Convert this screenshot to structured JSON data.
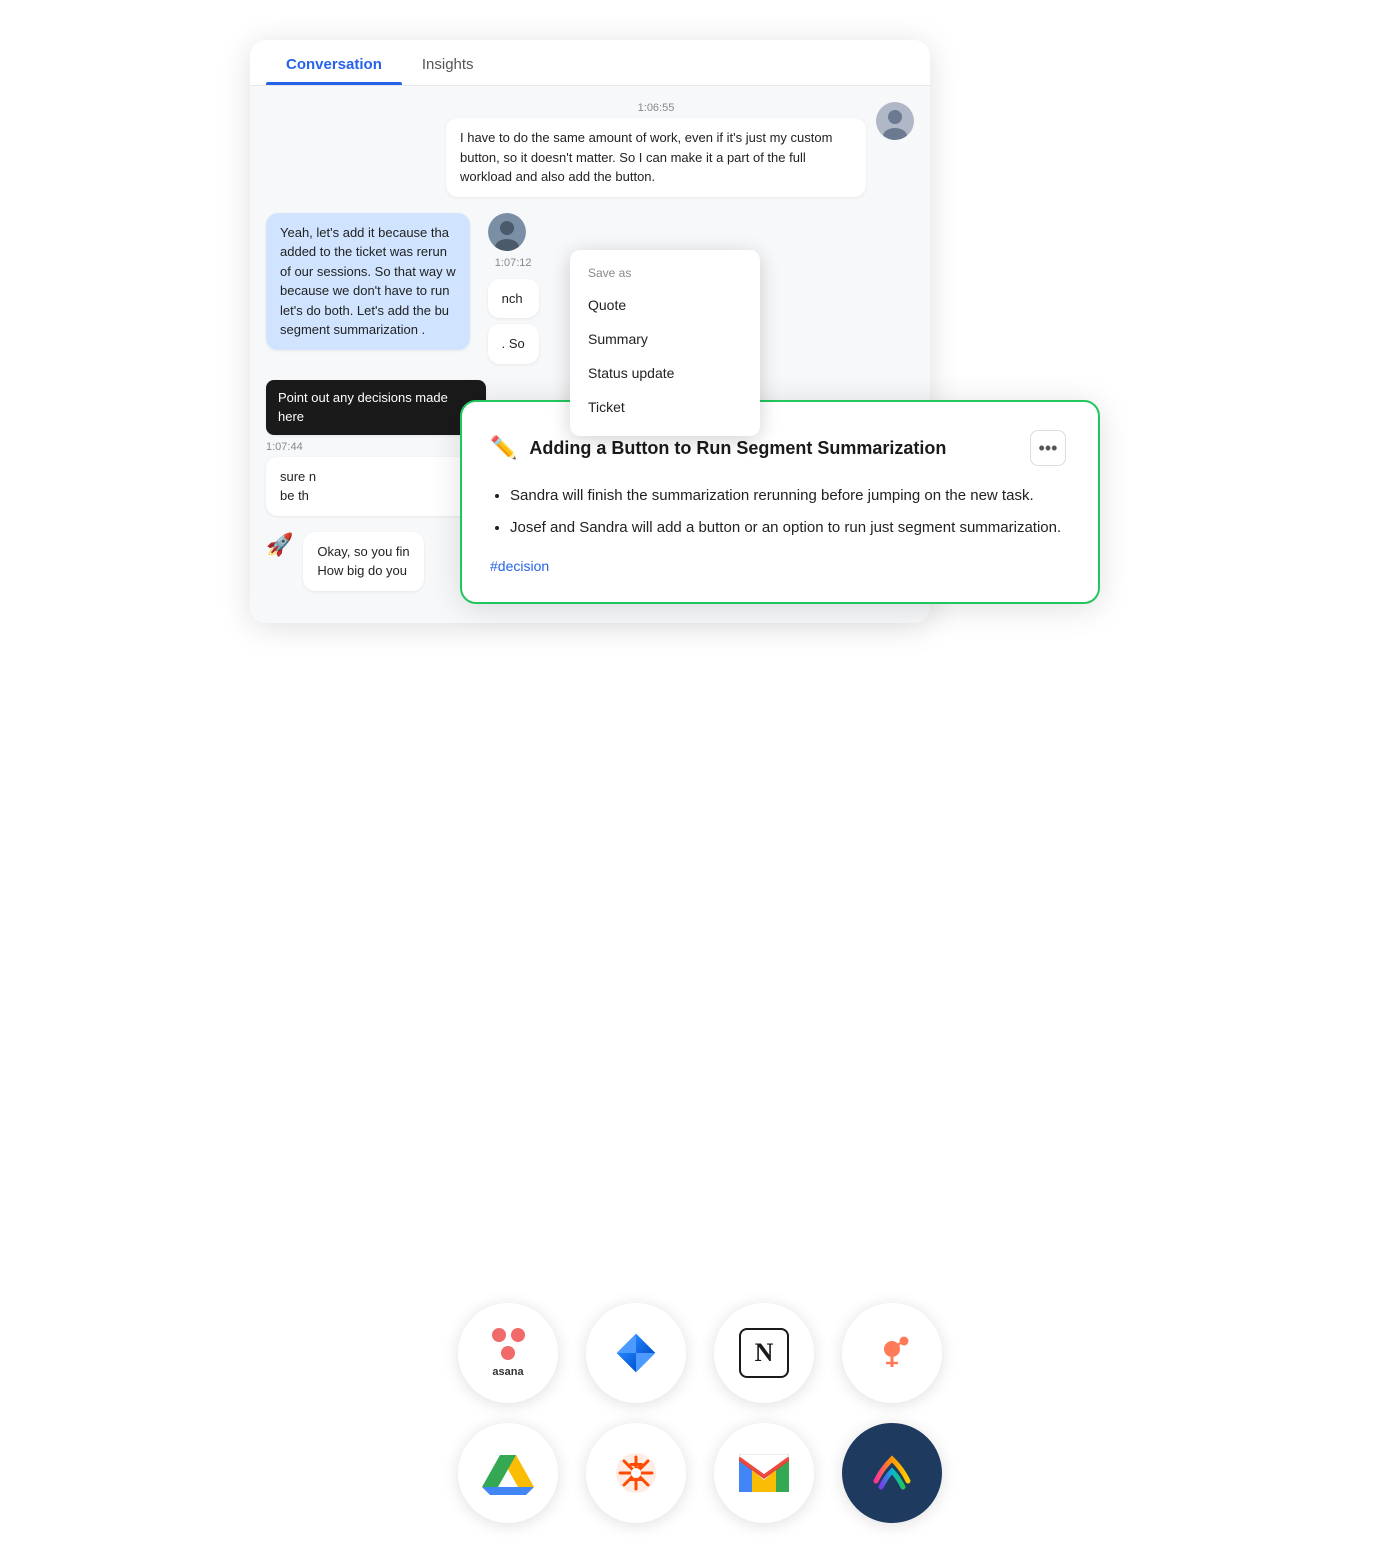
{
  "tabs": {
    "conversation": "Conversation",
    "insights": "Insights"
  },
  "messages": [
    {
      "timestamp": "1:06:55",
      "side": "right",
      "text": "I have to do the same amount of work, even if it's just my custom button, so it doesn't matter. So I can make it a part of the full workload and also add the button."
    },
    {
      "timestamp": "1:07:12",
      "side": "left",
      "text": "Yeah, let's add it because that added to the ticket was rerun of our sessions. So that way w because we don't have to run let's do both. Let's add the bu segment summarization .",
      "highlighted": true,
      "right_text": "nch",
      "right_text2": ". So"
    },
    {
      "side": "left",
      "timestamp": "1:07:44",
      "tooltip": "Point out any decisions made here",
      "text2": "sure n be th"
    },
    {
      "side": "left",
      "timestamp": "",
      "rocket": true,
      "text3": "Okay, so you fin How big do you"
    }
  ],
  "dropdown": {
    "header": "Save as",
    "items": [
      "Quote",
      "Summary",
      "Status update",
      "Ticket"
    ]
  },
  "insight_card": {
    "emoji": "✏️",
    "title": "Adding a Button to Run Segment Summarization",
    "menu_label": "•••",
    "bullets": [
      "Sandra will finish the summarization rerunning before jumping on the new task.",
      "Josef and Sandra will add a button or an option to run just segment summarization."
    ],
    "tag": "#decision"
  },
  "integrations": {
    "row1": [
      "asana",
      "jira",
      "notion",
      "hubspot"
    ],
    "row2": [
      "google-drive",
      "zapier",
      "gmail",
      "clickup"
    ]
  }
}
